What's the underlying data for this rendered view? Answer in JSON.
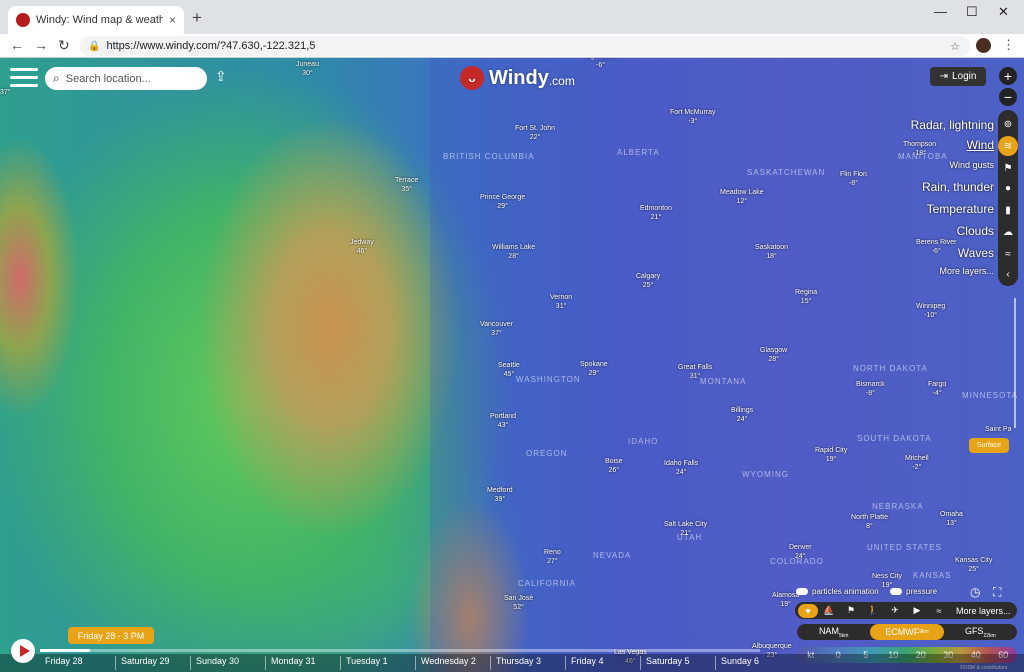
{
  "browser": {
    "tab_title": "Windy: Wind map & weather for",
    "tab_close": "×",
    "new_tab": "+",
    "url": "https://www.windy.com/?47.630,-122.321,5",
    "window_controls": [
      "—",
      "☐",
      "✕"
    ]
  },
  "header": {
    "search_placeholder": "Search location...",
    "logo_text": "Windy",
    "logo_suffix": ".com",
    "login_label": "Login"
  },
  "layers": {
    "items": [
      {
        "label": "Radar, lightning",
        "icon": "radar-icon",
        "active": false,
        "small": false
      },
      {
        "label": "Wind",
        "icon": "wind-icon",
        "active": true,
        "small": false
      },
      {
        "label": "Wind gusts",
        "icon": "flag-icon",
        "active": false,
        "small": true
      },
      {
        "label": "Rain, thunder",
        "icon": "rain-drop-icon",
        "active": false,
        "small": false
      },
      {
        "label": "Temperature",
        "icon": "thermometer-icon",
        "active": false,
        "small": false
      },
      {
        "label": "Clouds",
        "icon": "cloud-icon",
        "active": false,
        "small": false
      },
      {
        "label": "Waves",
        "icon": "waves-icon",
        "active": false,
        "small": false
      },
      {
        "label": "More layers...",
        "icon": "chevron-left-icon",
        "active": false,
        "small": true
      }
    ],
    "surface_label": "Surface"
  },
  "map": {
    "cities": [
      {
        "name": "Juneau",
        "temp": "30°"
      },
      {
        "name": "High Level",
        "temp": "-6°"
      },
      {
        "name": "Fort McMurray",
        "temp": "-3°"
      },
      {
        "name": "Fort St. John",
        "temp": "22°"
      },
      {
        "name": "Thompson",
        "temp": "-18°"
      },
      {
        "name": "Terrace",
        "temp": "35°"
      },
      {
        "name": "Prince George",
        "temp": "29°"
      },
      {
        "name": "Edmonton",
        "temp": "21°"
      },
      {
        "name": "Meadow Lake",
        "temp": "12°"
      },
      {
        "name": "Flin Flon",
        "temp": "-8°"
      },
      {
        "name": "Jedway",
        "temp": "46°"
      },
      {
        "name": "Williams Lake",
        "temp": "28°"
      },
      {
        "name": "Saskatoon",
        "temp": "18°"
      },
      {
        "name": "Berens River",
        "temp": "-6°"
      },
      {
        "name": "Calgary",
        "temp": "25°"
      },
      {
        "name": "Regina",
        "temp": "15°"
      },
      {
        "name": "Vernon",
        "temp": "31°"
      },
      {
        "name": "Winnipeg",
        "temp": "-10°"
      },
      {
        "name": "Vancouver",
        "temp": "37°"
      },
      {
        "name": "Glasgow",
        "temp": "28°"
      },
      {
        "name": "Seattle",
        "temp": "45°"
      },
      {
        "name": "Spokane",
        "temp": "29°"
      },
      {
        "name": "Great Falls",
        "temp": "31°"
      },
      {
        "name": "Bismarck",
        "temp": "-8°"
      },
      {
        "name": "Fargo",
        "temp": "-4°"
      },
      {
        "name": "Portland",
        "temp": "43°"
      },
      {
        "name": "Billings",
        "temp": "24°"
      },
      {
        "name": "Saint Pa",
        "temp": ""
      },
      {
        "name": "Rapid City",
        "temp": "19°"
      },
      {
        "name": "Mitchell",
        "temp": "-2°"
      },
      {
        "name": "Boise",
        "temp": "26°"
      },
      {
        "name": "Idaho Falls",
        "temp": "24°"
      },
      {
        "name": "Medford",
        "temp": "39°"
      },
      {
        "name": "North Platte",
        "temp": "8°"
      },
      {
        "name": "Omaha",
        "temp": "13°"
      },
      {
        "name": "Salt Lake City",
        "temp": "21°"
      },
      {
        "name": "Reno",
        "temp": "27°"
      },
      {
        "name": "Denver",
        "temp": "24°"
      },
      {
        "name": "Kansas City",
        "temp": "25°"
      },
      {
        "name": "Ness City",
        "temp": "19°"
      },
      {
        "name": "San José",
        "temp": "52°"
      },
      {
        "name": "Alamosa",
        "temp": "19°"
      },
      {
        "name": "Las Vegas",
        "temp": "46°"
      },
      {
        "name": "Albuquerque",
        "temp": "23°"
      }
    ],
    "regions": [
      "BRITISH COLUMBIA",
      "ALBERTA",
      "SASKATCHEWAN",
      "MANITOBA",
      "WASHINGTON",
      "MONTANA",
      "NORTH DAKOTA",
      "MINNESOTA",
      "OREGON",
      "IDAHO",
      "SOUTH DAKOTA",
      "WYOMING",
      "NEBRASKA",
      "NEVADA",
      "UTAH",
      "COLORADO",
      "KANSAS",
      "CALIFORNIA",
      "UNITED STATES"
    ],
    "left_edge_temp": "37°"
  },
  "controls": {
    "particles_label": "particles animation",
    "pressure_label": "pressure",
    "more_layers": "More layers...",
    "favorite_icons": [
      "heart-icon",
      "boat-icon",
      "flag-icon",
      "man-icon",
      "plane-icon",
      "camera-icon",
      "wave-icon"
    ],
    "models": [
      {
        "name": "NAM",
        "res": "5km",
        "active": false
      },
      {
        "name": "ECMWF",
        "res": "9km",
        "active": true
      },
      {
        "name": "GFS",
        "res": "22km",
        "active": false
      }
    ],
    "legend_unit": "kt",
    "legend_values": [
      "0",
      "5",
      "10",
      "20",
      "30",
      "40",
      "60"
    ],
    "attribution": "©OSM & contributors"
  },
  "timeline": {
    "current": "Friday 28 - 3 PM",
    "progress": 0.07,
    "days": [
      "Friday 28",
      "Saturday 29",
      "Sunday 30",
      "Monday 31",
      "Tuesday 1",
      "Wednesday 2",
      "Thursday 3",
      "Friday 4",
      "Saturday 5",
      "Sunday 6"
    ]
  }
}
